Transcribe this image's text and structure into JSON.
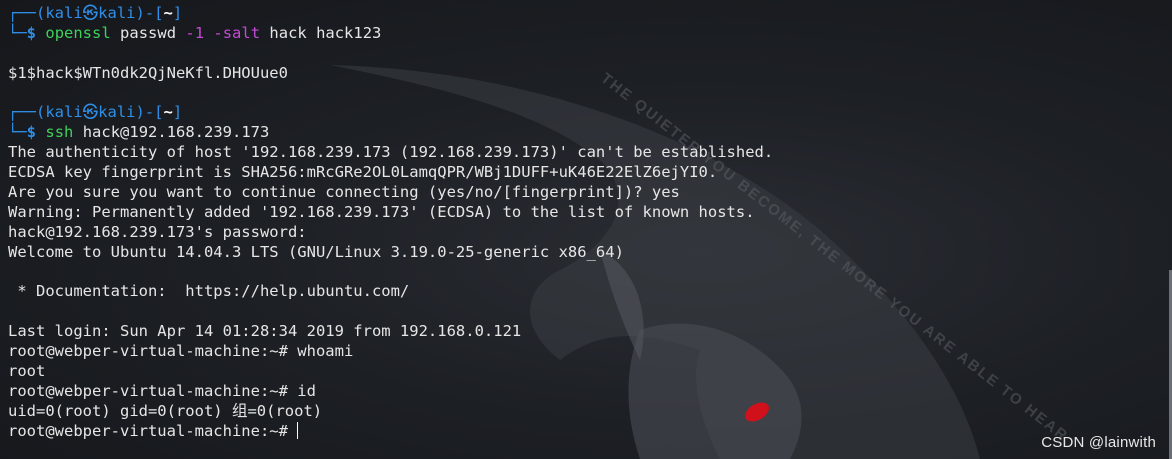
{
  "prompt": {
    "frame_top": "┌──(",
    "user": "kali",
    "at": "㉿",
    "host": "kali",
    "dir_open": ")-[",
    "dir": "~",
    "dir_close": "]",
    "frame_bottom": "└─",
    "dollar": "$"
  },
  "cmd1": {
    "name": "openssl",
    "arg1": "passwd",
    "opt1": "-1",
    "opt2": "-salt",
    "arg2": "hack hack123"
  },
  "out1": "$1$hack$WTn0dk2QjNeKfl.DHOUue0",
  "cmd2": {
    "name": "ssh",
    "arg1": "hack@192.168.239.173"
  },
  "session": [
    "The authenticity of host '192.168.239.173 (192.168.239.173)' can't be established.",
    "ECDSA key fingerprint is SHA256:mRcGRe2OL0LamqQPR/WBj1DUFF+uK46E22ElZ6ejYI0.",
    "Are you sure you want to continue connecting (yes/no/[fingerprint])? yes",
    "Warning: Permanently added '192.168.239.173' (ECDSA) to the list of known hosts.",
    "hack@192.168.239.173's password: ",
    "Welcome to Ubuntu 14.04.3 LTS (GNU/Linux 3.19.0-25-generic x86_64)",
    "",
    " * Documentation:  https://help.ubuntu.com/",
    "",
    "Last login: Sun Apr 14 01:28:34 2019 from 192.168.0.121",
    "root@webper-virtual-machine:~# whoami",
    "root",
    "root@webper-virtual-machine:~# id",
    "uid=0(root) gid=0(root) 组=0(root)"
  ],
  "remote_prompt": "root@webper-virtual-machine:~# ",
  "wallpaper_text": "THE QUIETER YOU BECOME, THE MORE YOU ARE ABLE TO HEAR",
  "watermark": "CSDN @lainwith",
  "colors": {
    "background": "#181b20",
    "text": "#e6e6e6",
    "prompt_blue": "#2f8fe8",
    "command_green": "#3fd15b",
    "option_purple": "#c54ad3",
    "dragon_eye_red": "#d0101a"
  }
}
